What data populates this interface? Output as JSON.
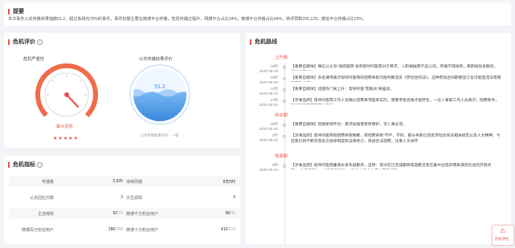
{
  "summary": {
    "title": "提要",
    "text": "本次事件公关传播效果指数51.2，超过系统内76%的事件。事件初期主要在微博平台传播，危机传播过程中，网媒平台占比34%；微博平台传播占比44%，转评赞数255,129；微信平台传播占比22%。"
  },
  "crisis_eval": {
    "title": "危机评价",
    "severity_label": "危机严重性",
    "severity_level": "最大风险",
    "stars": 5,
    "pr_label": "公共传播效果评价",
    "pr_score": "51.2",
    "pr_score_fraction": 0.512,
    "pr_caption": "公关传播效果评分：一般"
  },
  "indicators": {
    "title": "危机指标",
    "rows": [
      {
        "l1": "传播量",
        "v1": "5,935",
        "v1b": "",
        "l2": "持续周期",
        "v2": "8天5时",
        "v2b": ""
      },
      {
        "l1": "公关回应次数",
        "v1": "3",
        "v1b": "",
        "l2": "次生舆情",
        "v2": "0",
        "v2b": ""
      },
      {
        "l1": "主流媒体",
        "v1": "92",
        "v1b": "/70",
        "l2": "微博千万粉丝用户",
        "v2": "58",
        "v2b": "/40"
      },
      {
        "l1": "微博百万粉丝用户",
        "v1": "286",
        "v1b": "/288",
        "l2": "微博十万粉丝用户",
        "v2": "416",
        "v2b": "/524"
      }
    ]
  },
  "timeline": {
    "title": "危机路线",
    "sections": [
      {
        "label": "上升期",
        "items": [
          {
            "time": "18时",
            "date": "2020-08-19",
            "text": "【重要自媒体】微信公众号“海底医院”发布帮呼吁医院对于要求，入职根据原产品公司。传播不得规则，离职规划发服务。引发全网关注。"
          },
          {
            "time": "19时",
            "date": "2020-08-20",
            "text": "【重要自媒体】多名律师表示帮呼吁医院的招聘条款可能判断违反《劳动合同法》，这种劳动合同即使签订也可能因违法等而属无效合同。"
          },
          {
            "time": "14时",
            "date": "2020-08-20",
            "text": "【重要自媒体】话题热门关上升：帮呼吁医“套路员”来描述。"
          },
          {
            "time": "17时",
            "date": "2020-08-20",
            "text": "【涉事品牌】帮呼吁医院工作人员确认招聘事项是真实的，需要考核合格才能转生。一位入事部工作人员表示，招聘条件，签录就可在是要部分告知。"
          }
        ]
      },
      {
        "label": "热议期",
        "items": [
          {
            "time": "18时",
            "date": "2020-08-20",
            "text": "【重要自媒体】智能新闻平台：要求加强者有所保护，求入事必须。"
          },
          {
            "time": "2时",
            "date": "2020-08-22",
            "text": "【涉事品牌】帮呼吁医院就招聘条款致歉，称招聘条款“不严，不好，部分条款已违反劳动合同法相关规定以及人文精神。今后我们将不断完善此次规章制度和法律修订。改进合法招聘，注重人文关怀"
          }
        ]
      },
      {
        "label": "衰退期",
        "items": [
          {
            "time": "9时",
            "date": "2020-08-24",
            "text": "【涉事品牌】帮呼吁医院董事长发布道歉声，自称：我对在已完成删除或道歉还有在集中出现声明来满足社会的开放问题，“他自己压力，也就有日当对”，针对人和企业成本都有好的。"
          }
        ]
      }
    ]
  },
  "float_button": {
    "label": "危机评估"
  },
  "colors": {
    "accent": "#e8534a",
    "gauge_blue": "#3f8fe0",
    "bg": "#f2f4f7"
  }
}
